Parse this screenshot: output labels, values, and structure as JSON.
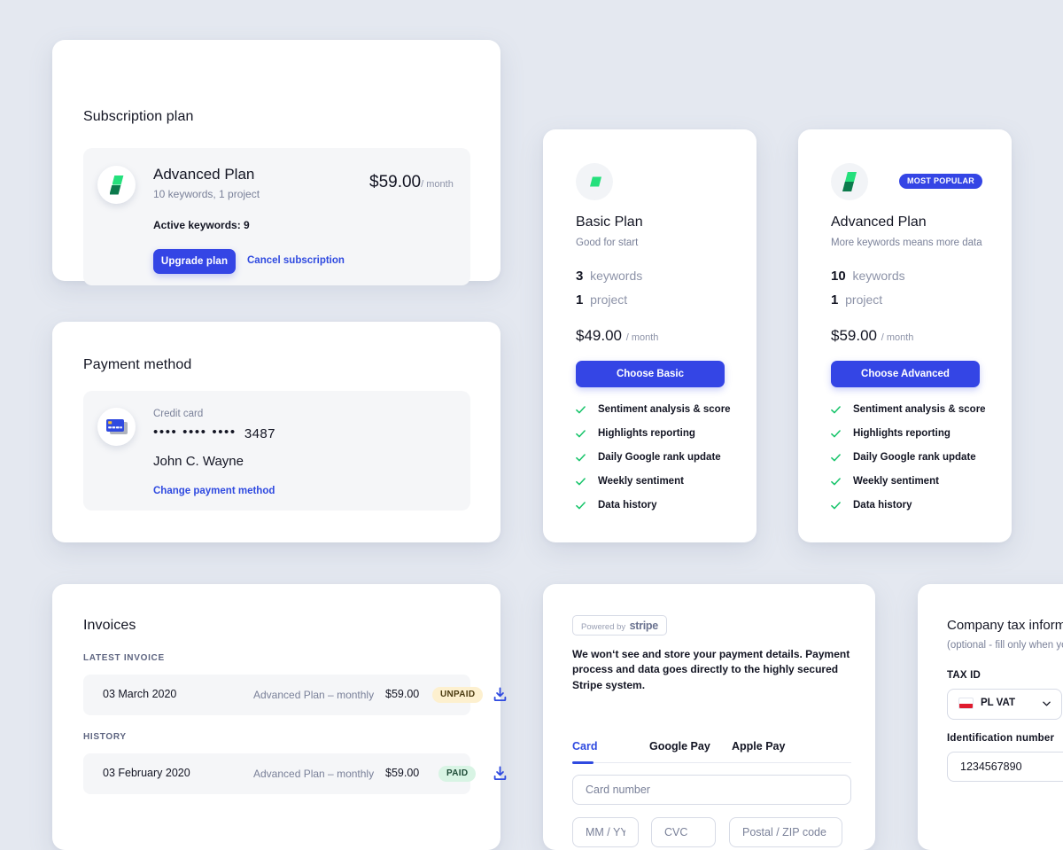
{
  "subscription": {
    "title": "Subscription plan",
    "plan_name": "Advanced Plan",
    "plan_sub": "10 keywords, 1 project",
    "active_keywords": "Active keywords: 9",
    "price": "$59.00",
    "price_period": "/ month",
    "upgrade_label": "Upgrade plan",
    "cancel_label": "Cancel subscription"
  },
  "payment": {
    "title": "Payment method",
    "card_label": "Credit card",
    "card_dots": "••••  ••••  ••••",
    "card_last4": "3487",
    "card_holder": "John C. Wayne",
    "change_label": "Change payment method"
  },
  "plans": [
    {
      "id": "basic",
      "name": "Basic Plan",
      "desc": "Good for start",
      "keywords_count": "3",
      "keywords_label": "keywords",
      "projects_count": "1",
      "projects_label": "project",
      "price": "$49.00",
      "price_period": "/ month",
      "cta": "Choose Basic",
      "badge": "",
      "features": [
        "Sentiment analysis & score",
        "Highlights reporting",
        "Daily Google rank update",
        "Weekly sentiment",
        "Data history"
      ]
    },
    {
      "id": "advanced",
      "name": "Advanced Plan",
      "desc": "More keywords means more data",
      "keywords_count": "10",
      "keywords_label": "keywords",
      "projects_count": "1",
      "projects_label": "project",
      "price": "$59.00",
      "price_period": "/ month",
      "cta": "Choose Advanced",
      "badge": "MOST POPULAR",
      "features": [
        "Sentiment analysis & score",
        "Highlights reporting",
        "Daily Google rank update",
        "Weekly sentiment",
        "Data history"
      ]
    }
  ],
  "invoices": {
    "title": "Invoices",
    "latest_label": "LATEST INVOICE",
    "history_label": "HISTORY",
    "latest": {
      "date": "03 March 2020",
      "description": "Advanced Plan – monthly",
      "amount": "$59.00",
      "status": "UNPAID"
    },
    "history": [
      {
        "date": "03 February 2020",
        "description": "Advanced Plan – monthly",
        "amount": "$59.00",
        "status": "PAID"
      }
    ]
  },
  "stripe": {
    "powered_by": "Powered by",
    "brand": "stripe",
    "note": "We won‘t see and store your payment details. Payment process and data goes directly to the highly secured Stripe system.",
    "tabs": [
      "Card",
      "Google Pay",
      "Apple Pay"
    ],
    "card_number_placeholder": "Card number",
    "expiry_placeholder": "MM / YY",
    "cvc_placeholder": "CVC",
    "postal_placeholder": "Postal / ZIP code"
  },
  "tax": {
    "title": "Company tax information",
    "subtitle": "(optional - fill only when you",
    "tax_id_label": "TAX ID",
    "tax_id_value": "PL VAT",
    "identification_label": "Identification number",
    "identification_value": "1234567890"
  },
  "colors": {
    "page_bg": "#e4e8f0",
    "accent_blue": "#3445e5",
    "link_blue": "#2f4ae0",
    "green_light": "#25e07c",
    "green_dark": "#0c7a4c",
    "unpaid_bg": "#fdf0cf",
    "paid_bg": "#d8f4e4"
  }
}
